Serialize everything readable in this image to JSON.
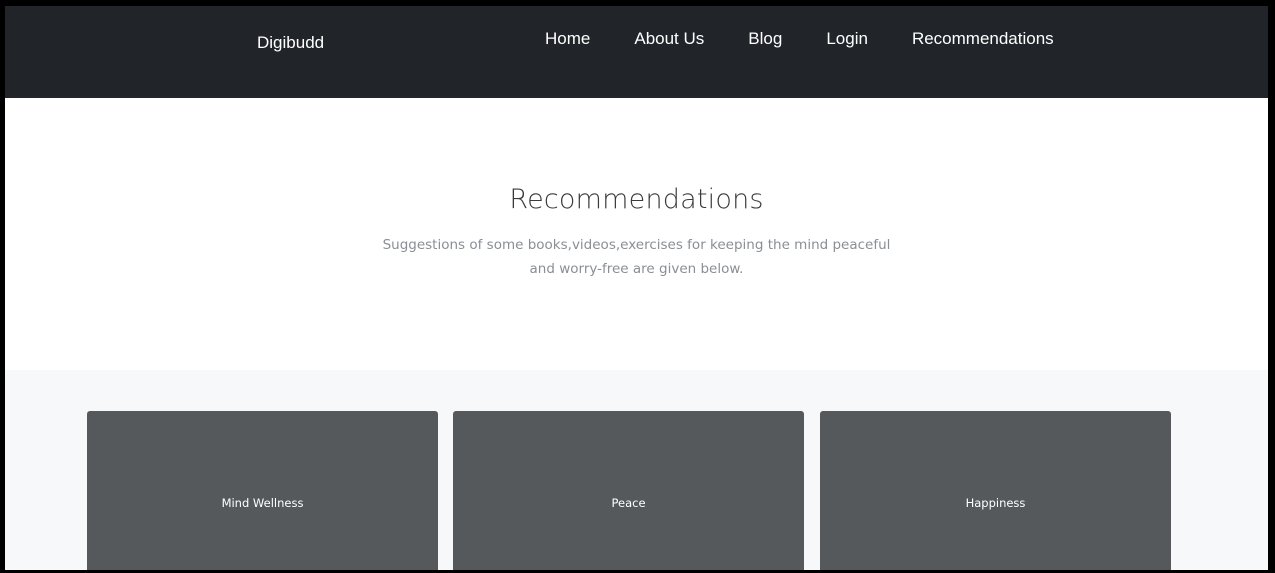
{
  "navbar": {
    "brand": "Digibudd",
    "links": [
      "Home",
      "About Us",
      "Blog",
      "Login",
      "Recommendations"
    ],
    "background": "#212529"
  },
  "hero": {
    "title": "Recommendations",
    "subtitle_line1": "Suggestions of some books,videos,exercises for keeping the mind peaceful",
    "subtitle_line2": "and worry-free are given below."
  },
  "cards": [
    {
      "label": "Mind Wellness"
    },
    {
      "label": "Peace"
    },
    {
      "label": "Happiness"
    }
  ],
  "colors": {
    "card": "#55595c",
    "section_bg": "#f7f8fa"
  }
}
